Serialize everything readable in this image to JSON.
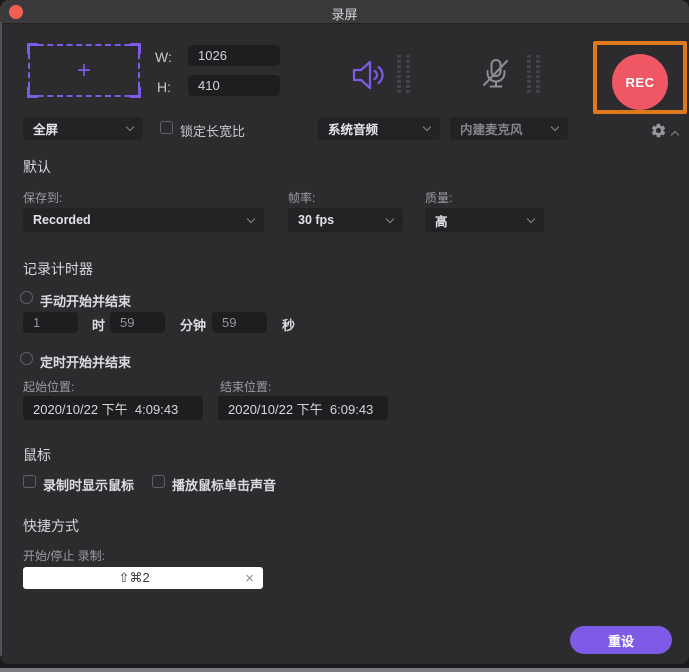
{
  "window": {
    "title": "录屏"
  },
  "capture": {
    "w_label": "W:",
    "w_value": "1026",
    "h_label": "H:",
    "h_value": "410",
    "area_mode_value": "全屏",
    "lock_aspect_label": "锁定长宽比"
  },
  "audio": {
    "system_audio_value": "系统音频",
    "microphone_value": "内建麦克风"
  },
  "rec": {
    "label": "REC"
  },
  "defaults": {
    "header": "默认",
    "save_to_label": "保存到:",
    "save_to_value": "Recorded",
    "framerate_label": "帧率:",
    "framerate_value": "30 fps",
    "quality_label": "质量:",
    "quality_value": "高"
  },
  "timer": {
    "header": "记录计时器",
    "manual_label": "手动开始并结束",
    "hours_value": "1",
    "hours_unit": "时",
    "minutes_value": "59",
    "minutes_unit": "分钟",
    "seconds_value": "59",
    "seconds_unit": "秒",
    "scheduled_label": "定时开始并结束",
    "start_label": "起始位置:",
    "start_value": "2020/10/22 下午  4:09:43",
    "end_label": "结束位置:",
    "end_value": "2020/10/22 下午  6:09:43"
  },
  "mouse": {
    "header": "鼠标",
    "show_cursor_label": "录制时显示鼠标",
    "click_sound_label": "播放鼠标单击声音"
  },
  "shortcuts": {
    "header": "快捷方式",
    "record_hotkey_label": "开始/停止 录制:",
    "hotkey_value": "⇧⌘2",
    "clear_glyph": "×"
  },
  "footer": {
    "reset_label": "重设"
  },
  "colors": {
    "accent": "#7d5be6",
    "rec-red": "#ee5763",
    "rec-frame": "#e0781c",
    "body-bg": "#2c2b2e",
    "titlebar-bg": "#3a393b"
  }
}
